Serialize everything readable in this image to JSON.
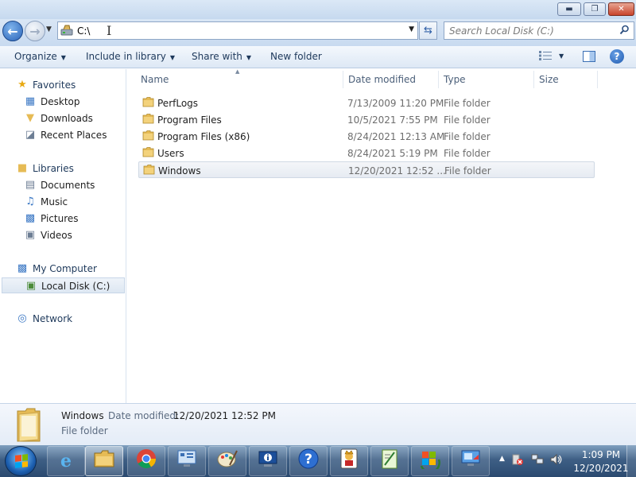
{
  "window": {
    "minimize_label": "▬",
    "maximize_label": "❐",
    "close_label": "✕"
  },
  "navigation": {
    "address": "C:\\",
    "search_placeholder": "Search Local Disk (C:)"
  },
  "toolbar": {
    "organize": "Organize",
    "include_in_library": "Include in library",
    "share_with": "Share with",
    "new_folder": "New folder"
  },
  "sidebar": {
    "favorites": {
      "label": "Favorites",
      "items": [
        {
          "label": "Desktop",
          "icon": "desktop-icon"
        },
        {
          "label": "Downloads",
          "icon": "downloads-icon"
        },
        {
          "label": "Recent Places",
          "icon": "recent-places-icon"
        }
      ]
    },
    "libraries": {
      "label": "Libraries",
      "items": [
        {
          "label": "Documents",
          "icon": "documents-icon"
        },
        {
          "label": "Music",
          "icon": "music-icon"
        },
        {
          "label": "Pictures",
          "icon": "pictures-icon"
        },
        {
          "label": "Videos",
          "icon": "videos-icon"
        }
      ]
    },
    "computer": {
      "label": "My Computer",
      "items": [
        {
          "label": "Local Disk (C:)",
          "icon": "local-disk-icon",
          "selected": true
        }
      ]
    },
    "network": {
      "label": "Network"
    }
  },
  "file_list": {
    "columns": [
      "Name",
      "Date modified",
      "Type",
      "Size"
    ],
    "rows": [
      {
        "name": "PerfLogs",
        "date": "7/13/2009 11:20 PM",
        "type": "File folder",
        "size": ""
      },
      {
        "name": "Program Files",
        "date": "10/5/2021 7:55 PM",
        "type": "File folder",
        "size": ""
      },
      {
        "name": "Program Files (x86)",
        "date": "8/24/2021 12:13 AM",
        "type": "File folder",
        "size": ""
      },
      {
        "name": "Users",
        "date": "8/24/2021 5:19 PM",
        "type": "File folder",
        "size": ""
      },
      {
        "name": "Windows",
        "date": "12/20/2021 12:52 ...",
        "type": "File folder",
        "size": "",
        "selected": true
      }
    ]
  },
  "details": {
    "name": "Windows",
    "modified_label": "Date modified:",
    "modified_value": "12/20/2021 12:52 PM",
    "type": "File folder"
  },
  "taskbar": {
    "apps": [
      {
        "name": "internet-explorer-icon",
        "active": false
      },
      {
        "name": "file-explorer-icon",
        "active": true
      },
      {
        "name": "chrome-icon",
        "active": false
      },
      {
        "name": "control-panel-icon",
        "active": false
      },
      {
        "name": "paint-icon",
        "active": false
      },
      {
        "name": "system-info-icon",
        "active": false
      },
      {
        "name": "help-icon",
        "active": false
      },
      {
        "name": "solitaire-icon",
        "active": false
      },
      {
        "name": "notepad-plus-plus-icon",
        "active": false
      },
      {
        "name": "windows-update-icon",
        "active": false
      },
      {
        "name": "remote-desktop-icon",
        "active": false
      }
    ],
    "time": "1:09 PM",
    "date": "12/20/2021"
  },
  "colors": {
    "accent": "#2a63b8",
    "folder": "#e6bb55",
    "taskbar": "#3e5f85"
  }
}
